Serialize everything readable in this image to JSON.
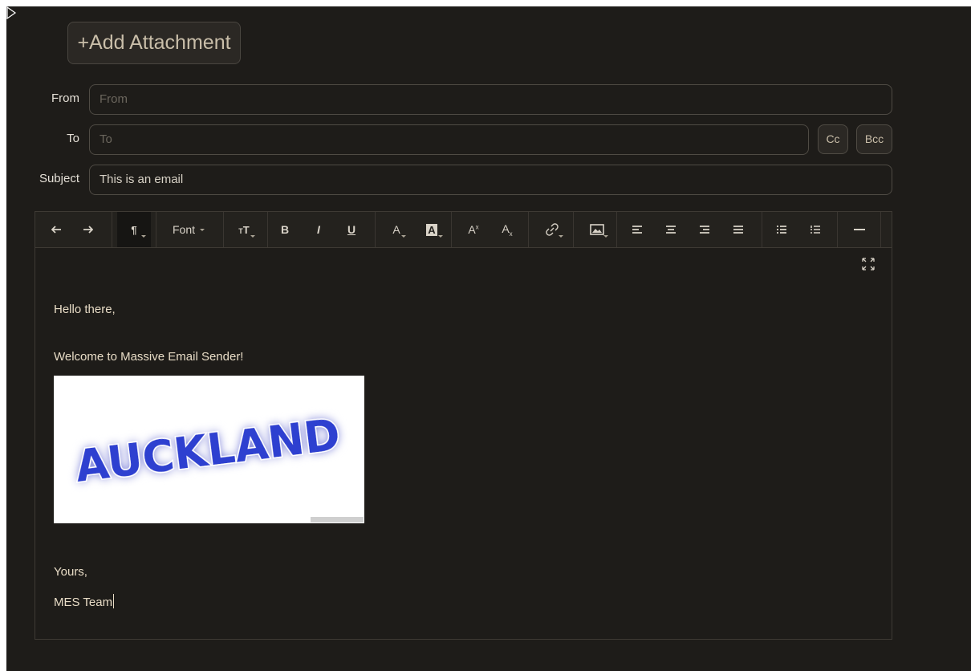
{
  "attach_button": {
    "label": "+Add Attachment"
  },
  "form": {
    "from_label": "From",
    "from_placeholder": "From",
    "to_label": "To",
    "to_placeholder": "To",
    "cc_label": "Cc",
    "bcc_label": "Bcc",
    "subject_label": "Subject",
    "subject_value": "This is an email"
  },
  "toolbar": {
    "font_label": "Font",
    "bold": "B",
    "italic": "I",
    "underline": "U",
    "font_color": "A",
    "bg_color": "A"
  },
  "body": {
    "greeting": "Hello there,",
    "welcome": "Welcome to Massive Email Sender!",
    "image_text": "AUCKLAND",
    "closing": "Yours,",
    "signature": "MES Team"
  },
  "colors": {
    "background": "#1e1c19",
    "text": "#e8dcc6",
    "image_text": "#2f3fd0"
  }
}
